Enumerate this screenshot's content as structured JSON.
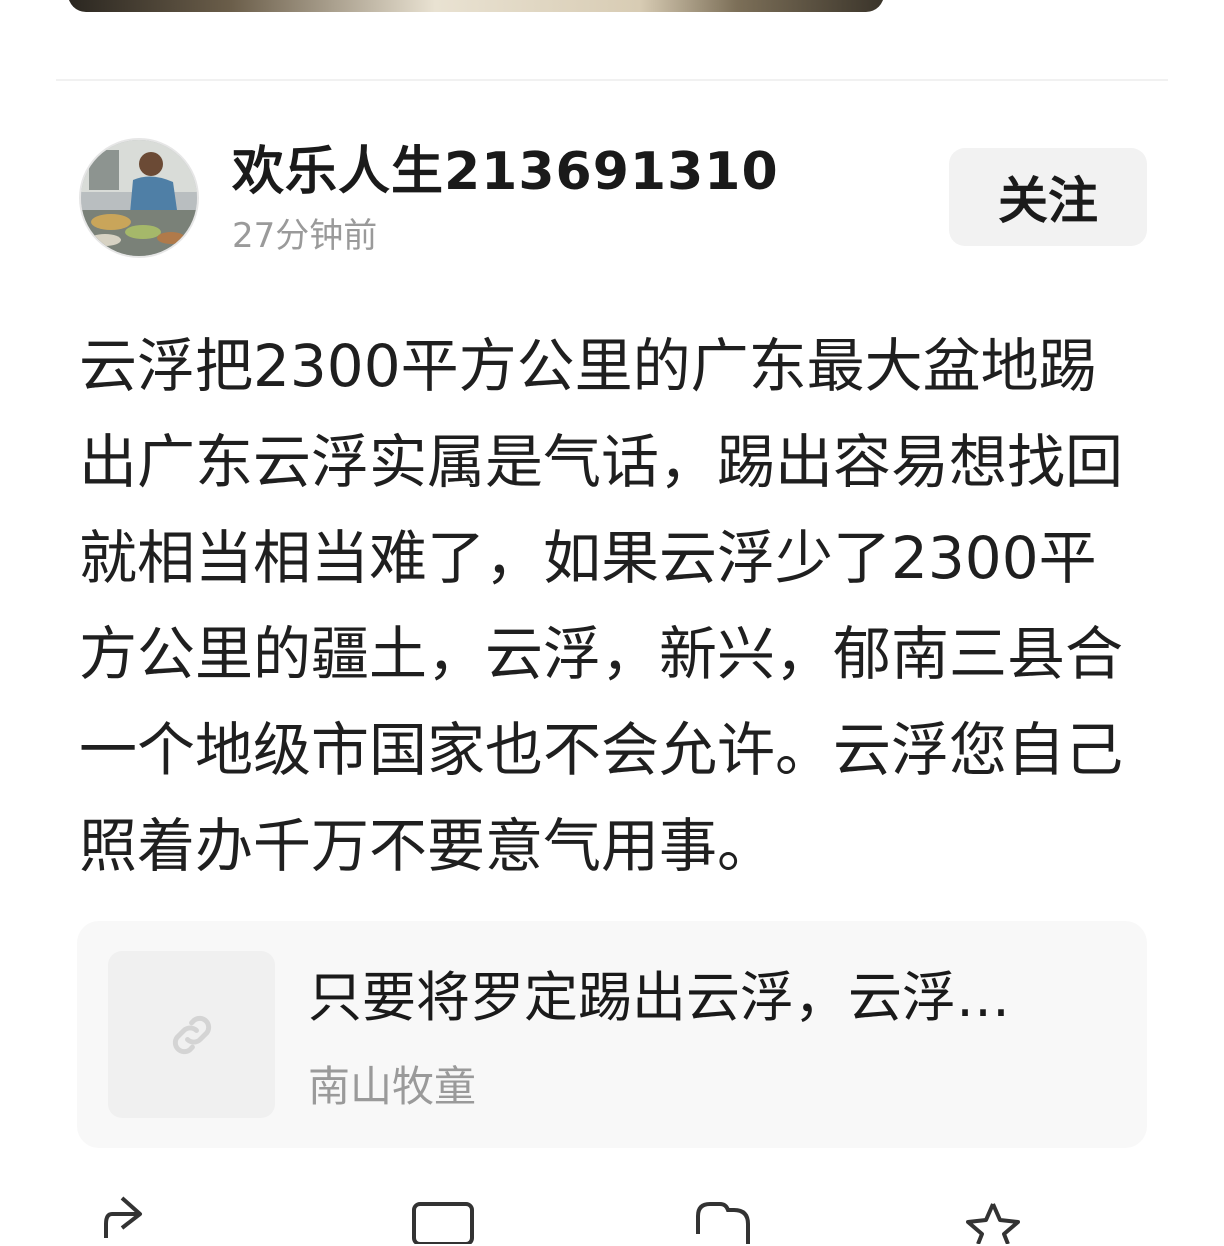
{
  "post": {
    "author": {
      "name": "欢乐人生213691310",
      "time": "27分钟前",
      "avatar_icon": "user-photo"
    },
    "follow_label": "关注",
    "text": "云浮把2300平方公里的广东最大盆地踢出广东云浮实属是气话，踢出容易想找回就相当相当难了，如果云浮少了2300平方公里的疆土，云浮，新兴，郁南三县合一个地级市国家也不会允许。云浮您自己照着办千万不要意气用事。",
    "link_card": {
      "title": "只要将罗定踢出云浮，云浮…",
      "author": "南山牧童",
      "icon": "link-icon"
    }
  },
  "colors": {
    "follow_bg": "#f2f2f2",
    "card_bg": "#f8f8f8",
    "muted_text": "#9a9a9a"
  }
}
